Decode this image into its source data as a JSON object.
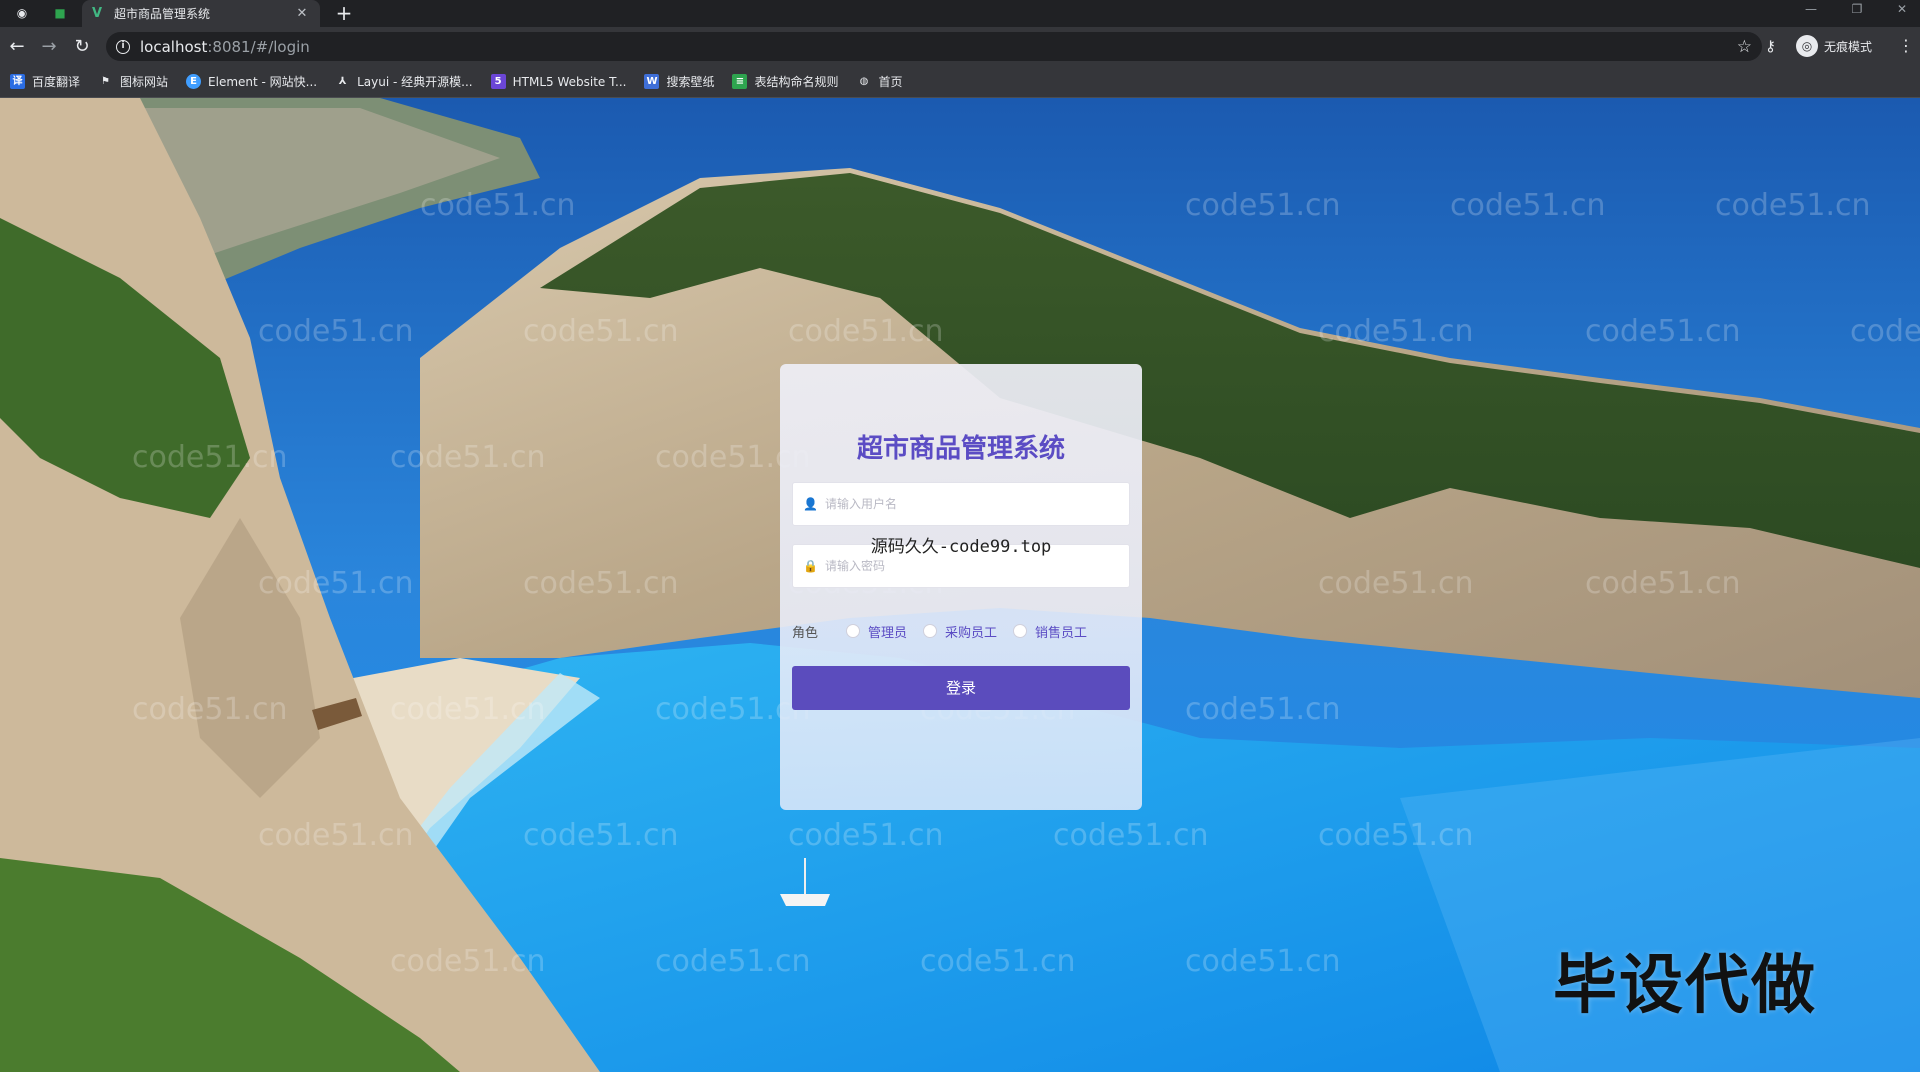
{
  "browser": {
    "tab_title": "超市商品管理系统",
    "address": {
      "host": "localhost",
      "rest": ":8081/#/login"
    },
    "profile_label": "无痕模式",
    "bookmarks": [
      {
        "label": "百度翻译",
        "icon": "baidu-translate-icon",
        "color": "#2b6de3"
      },
      {
        "label": "图标网站",
        "icon": "flag-icon",
        "color": "#35363a"
      },
      {
        "label": "Element - 网站快...",
        "icon": "element-icon",
        "color": "#409eff"
      },
      {
        "label": "Layui - 经典开源模...",
        "icon": "layui-icon",
        "color": "#35363a"
      },
      {
        "label": "HTML5 Website T...",
        "icon": "html5-icon",
        "color": "#6b46d6"
      },
      {
        "label": "搜索壁纸",
        "icon": "wallpaper-icon",
        "color": "#3f6fd8"
      },
      {
        "label": "表结构命名规则",
        "icon": "table-icon",
        "color": "#2ea44f"
      },
      {
        "label": "首页",
        "icon": "globe-icon",
        "color": "#35363a"
      }
    ]
  },
  "login": {
    "title": "超市商品管理系统",
    "username_placeholder": "请输入用户名",
    "password_placeholder": "请输入密码",
    "role_label": "角色",
    "roles": [
      "管理员",
      "采购员工",
      "销售员工"
    ],
    "submit_label": "登录"
  },
  "overlay_text": "源码久久-code99.top",
  "watermark_text": "code51.cn",
  "stamp_text": "毕设代做",
  "colors": {
    "accent": "#5b4cbd",
    "title": "#5b4cc4"
  }
}
